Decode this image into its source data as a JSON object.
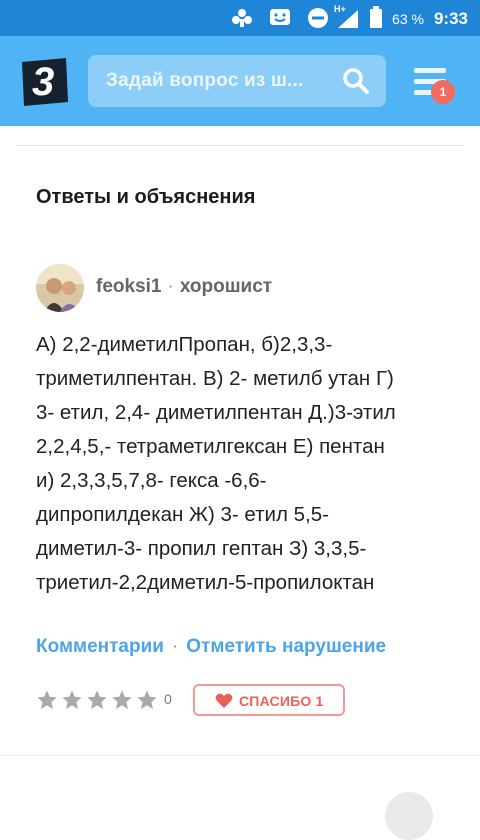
{
  "status_bar": {
    "battery_percent": "63 %",
    "time": "9:33",
    "network": "H+"
  },
  "header": {
    "logo_letter": "3",
    "search_placeholder": "Задай вопрос из ш...",
    "menu_badge": "1"
  },
  "section": {
    "title": "Ответы и объяснения"
  },
  "answer": {
    "user_name": "feoksi1",
    "separator": "·",
    "user_rank": "хорошист",
    "text_lines": [
      "А) 2,2-диметилПропан, б)2,3,3-",
      "триметилпентан. В) 2- метилб утан Г)",
      "3- етил, 2,4- диметилпентан Д.)3-этил",
      "2,2,4,5,- тетраметилгексан Е) пентан",
      "и) 2,3,3,5,7,8- гекса -6,6-",
      "дипропилдекан Ж) 3- етил 5,5-",
      "диметил-3- пропил гептан З) 3,3,5-",
      "триетил-2,2диметил-5-пропилоктан"
    ],
    "links": {
      "comments": "Комментарии",
      "separator": "·",
      "report": "Отметить нарушение"
    },
    "rating": {
      "stars_filled": 0,
      "stars_total": 5,
      "count": "0"
    },
    "thanks": {
      "label": "СПАСИБО 1"
    }
  },
  "colors": {
    "status_bar": "#1f85d6",
    "header": "#4fb3f6",
    "link": "#4da4ea",
    "badge": "#f36a5f",
    "thanks": "#e8625a"
  }
}
